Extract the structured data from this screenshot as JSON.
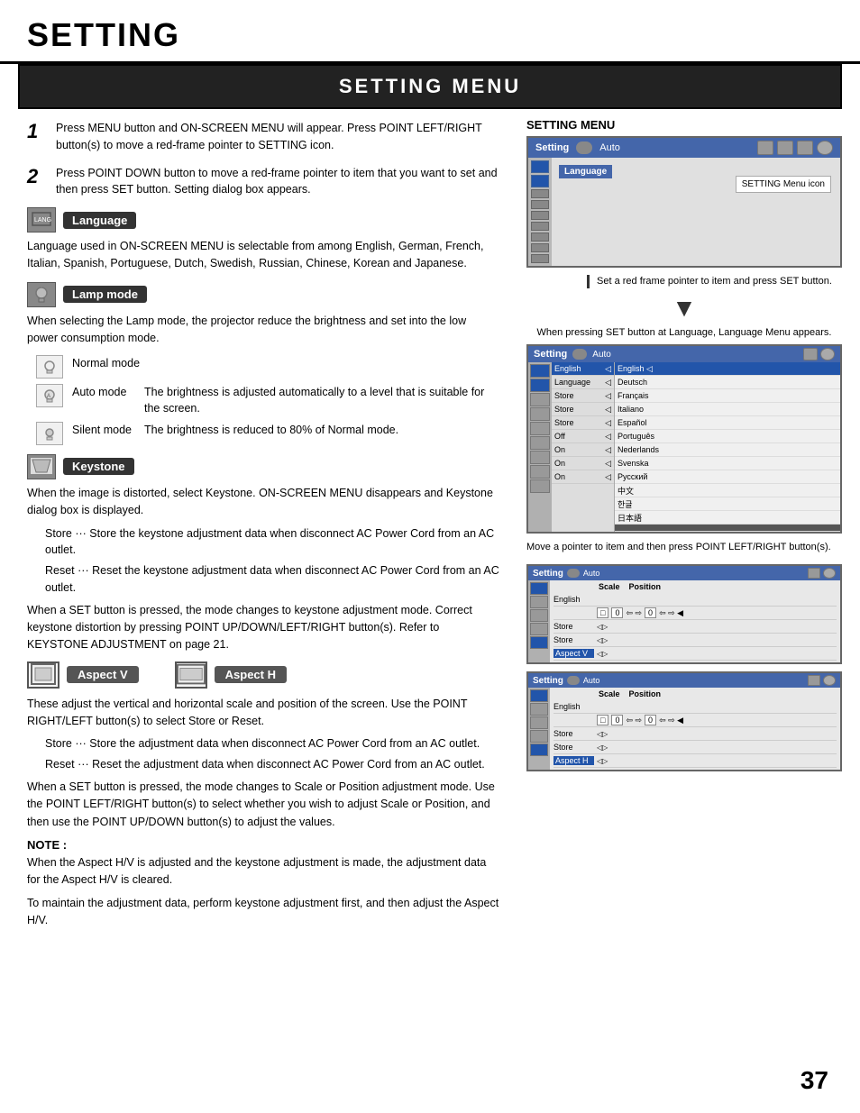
{
  "header": {
    "title": "SETTING"
  },
  "section": {
    "title": "SETTING MENU"
  },
  "steps": [
    {
      "num": "1",
      "text": "Press MENU button and ON-SCREEN MENU will appear.  Press POINT LEFT/RIGHT button(s) to move a red-frame pointer to SETTING icon."
    },
    {
      "num": "2",
      "text": "Press POINT DOWN button to move a red-frame pointer to item that you want to set and then press SET button.  Setting dialog box appears."
    }
  ],
  "features": {
    "language": {
      "label": "Language",
      "description": "Language used in ON-SCREEN MENU is selectable from among English, German, French, Italian, Spanish, Portuguese, Dutch, Swedish, Russian, Chinese, Korean and Japanese."
    },
    "lamp_mode": {
      "label": "Lamp mode",
      "description_top": "When selecting the Lamp mode, the projector reduce the brightness and set into the low power consumption mode.",
      "modes": [
        {
          "name": "Normal mode",
          "desc": ""
        },
        {
          "name": "Auto mode",
          "desc": "The brightness is adjusted automatically to a level that is suitable for the screen."
        },
        {
          "name": "Silent mode",
          "desc": "The brightness is reduced to 80% of Normal mode."
        }
      ]
    },
    "keystone": {
      "label": "Keystone",
      "description": "When the image is distorted, select Keystone.  ON-SCREEN MENU disappears and Keystone dialog box is displayed.",
      "items": [
        "Store ···  Store the keystone adjustment data when disconnect AC Power Cord from an AC outlet.",
        "Reset ···  Reset the keystone adjustment data when disconnect AC Power Cord from an AC outlet."
      ],
      "note": "When a SET button is pressed, the mode changes to keystone adjustment mode. Correct keystone distortion by pressing POINT UP/DOWN/LEFT/RIGHT button(s). Refer to KEYSTONE ADJUSTMENT on page 21."
    },
    "aspect_v": {
      "label": "Aspect V"
    },
    "aspect_h": {
      "label": "Aspect H"
    },
    "aspect_description": "These adjust the vertical and horizontal scale and position of the screen. Use the POINT RIGHT/LEFT button(s) to select Store or Reset.",
    "aspect_store": "Store ···  Store the adjustment data when disconnect AC Power Cord from an AC outlet.",
    "aspect_reset": "Reset ···  Reset the adjustment data when disconnect AC Power Cord from an AC outlet.",
    "aspect_set_note": "When a SET button is pressed, the mode changes to Scale or Position adjustment mode. Use the POINT LEFT/RIGHT button(s) to select whether you wish to adjust Scale or Position, and then use the POINT UP/DOWN button(s) to adjust the values."
  },
  "note": {
    "label": "NOTE :",
    "lines": [
      "When the Aspect H/V is adjusted and the keystone adjustment is made, the adjustment data for the Aspect H/V is cleared.",
      "To maintain the adjustment data, perform keystone adjustment first, and then adjust the Aspect H/V."
    ]
  },
  "right_panel": {
    "setting_menu_label": "SETTING MENU",
    "menu_icon_label": "SETTING Menu icon",
    "red_frame_note": "Set a red frame pointer to item and press SET button.",
    "language_appear_note": "When pressing SET button at Language, Language Menu appears.",
    "lang_items": [
      "English",
      "Language",
      "Store",
      "Store",
      "Store",
      "Off",
      "On",
      "On",
      "On"
    ],
    "lang_list": [
      "English",
      "Deutsch",
      "Français",
      "Italiano",
      "Español",
      "Português",
      "Nederlands",
      "Svenska",
      "Русский",
      "中文",
      "한글",
      "日本語"
    ],
    "pointer_note": "Move a pointer to item and then press POINT LEFT/RIGHT button(s).",
    "aspect_v_scale_label": "Scale",
    "aspect_v_pos_label": "Position",
    "aspect_h_scale_label": "Scale",
    "aspect_h_pos_label": "Position"
  },
  "page_number": "37",
  "topbar": {
    "setting_label": "Setting",
    "auto_label": "Auto"
  }
}
